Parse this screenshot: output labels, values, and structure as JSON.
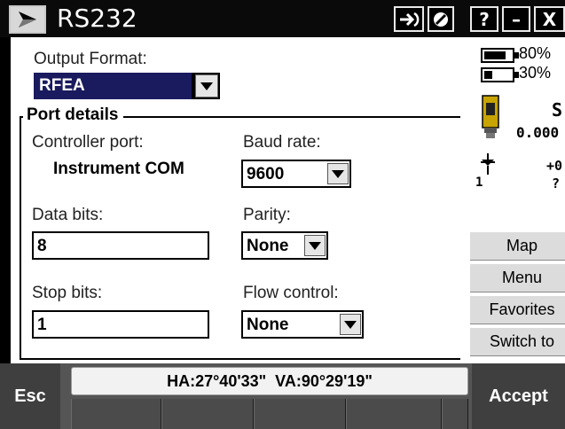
{
  "titlebar": {
    "title": "RS232",
    "buttons": {
      "help": "?",
      "minimize": "–",
      "close": "X"
    }
  },
  "form": {
    "output_format_label": "Output Format:",
    "output_format_value": "RFEA",
    "section_title": "Port details",
    "controller_port_label": "Controller port:",
    "controller_port_value": "Instrument COM",
    "baud_rate_label": "Baud rate:",
    "baud_rate_value": "9600",
    "data_bits_label": "Data bits:",
    "data_bits_value": "8",
    "parity_label": "Parity:",
    "parity_value": "None",
    "stop_bits_label": "Stop bits:",
    "stop_bits_value": "1",
    "flow_control_label": "Flow control:",
    "flow_control_value": "None"
  },
  "status": {
    "battery1_pct": "80%",
    "battery1_level": 0.8,
    "battery2_pct": "30%",
    "battery2_level": 0.3,
    "instrument_letter": "S",
    "instrument_value": "0.000",
    "target_value": "+0",
    "target_unknown": "?",
    "target_index": "1"
  },
  "side_buttons": [
    {
      "label": "Map"
    },
    {
      "label": "Menu"
    },
    {
      "label": "Favorites"
    },
    {
      "label": "Switch to"
    }
  ],
  "bottom": {
    "esc_label": "Esc",
    "accept_label": "Accept",
    "angles": "HA:27°40'33\"  VA:90°29'19\""
  },
  "colors": {
    "selection_bg": "#1a1a5e",
    "titlebar_bg": "#0a0a0a",
    "softkey_bg": "#3f3f3f"
  }
}
